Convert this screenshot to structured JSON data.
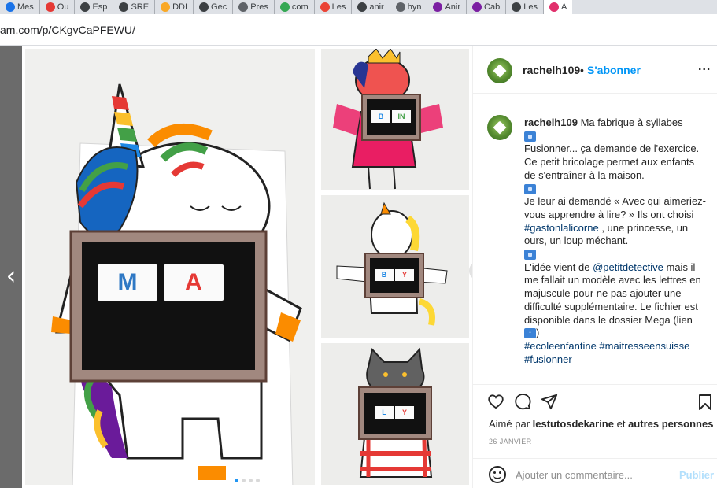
{
  "browser": {
    "tabs": [
      {
        "label": "Mes",
        "color": "#1a73e8"
      },
      {
        "label": "Ou",
        "color": "#e53935"
      },
      {
        "label": "Esp",
        "color": "#3c4043"
      },
      {
        "label": "SRE",
        "color": "#3c4043"
      },
      {
        "label": "DDI",
        "color": "#f9a825"
      },
      {
        "label": "Gec",
        "color": "#3c4043"
      },
      {
        "label": "Pres",
        "color": "#5f6368"
      },
      {
        "label": "com",
        "color": "#34a853"
      },
      {
        "label": "Les",
        "color": "#ea4335"
      },
      {
        "label": "anir",
        "color": "#3c4043"
      },
      {
        "label": "hyn",
        "color": "#5f6368"
      },
      {
        "label": "Anir",
        "color": "#7b1fa2"
      },
      {
        "label": "Cab",
        "color": "#7b1fa2"
      },
      {
        "label": "Les",
        "color": "#3c4043"
      },
      {
        "label": "A",
        "color": "#e1306c"
      }
    ],
    "url": "am.com/p/CKgvCaPFEWU/"
  },
  "carousel": {
    "prev_glyph": "‹",
    "next_glyph": "›",
    "letters_main": [
      "M",
      "A"
    ],
    "letters_1": [
      "B",
      "IN"
    ],
    "letters_2": [
      "B",
      "Y"
    ],
    "letters_3": [
      "L",
      "Y"
    ]
  },
  "post": {
    "username": "rachelh109",
    "separator": "•",
    "follow_label": "S'abonner",
    "more_label": "...",
    "caption": {
      "username": "rachelh109",
      "title": "Ma fabrique à syllabes",
      "p1": "Fusionner... ça demande de l'exercice. Ce petit bricolage permet aux enfants de s'entraîner à la maison.",
      "p2_a": "Je leur ai demandé « Avec qui aimeriez-vous apprendre à lire? » Ils ont choisi",
      "p2_link": "#gastonlalicorne",
      "p2_b": ", une princesse, un ours, un loup méchant.",
      "p3_a": "L'idée vient de",
      "p3_link": "@petitdetective",
      "p3_b": "mais il me fallait un modèle avec les lettres en majuscule pour ne pas ajouter une difficulté supplémentaire. Le fichier est disponible dans le dossier Mega (lien",
      "p3_c": ")",
      "hashtags": "#ecoleenfantine #maitresseensuisse #fusionner"
    },
    "liked_prefix": "Aimé par",
    "liked_user": "lestutosdekarine",
    "liked_mid": "et",
    "liked_others": "autres personnes",
    "date": "26 JANVIER",
    "comment_placeholder": "Ajouter un commentaire...",
    "publish_label": "Publier"
  },
  "colors": {
    "follow_blue": "#0095f6",
    "publish_disabled": "#b2dffc",
    "emoji_blue": "#3b82d6"
  }
}
